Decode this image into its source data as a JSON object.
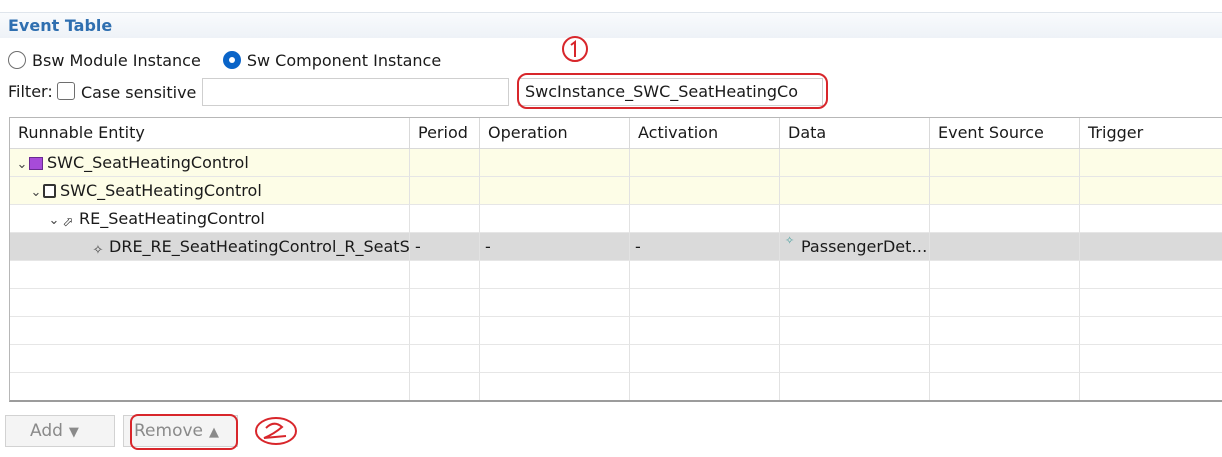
{
  "section": {
    "title": "Event Table"
  },
  "radios": [
    {
      "label": "Bsw Module Instance",
      "checked": false
    },
    {
      "label": "Sw Component Instance",
      "checked": true
    }
  ],
  "filter": {
    "label": "Filter:",
    "case_sensitive_label": "Case sensitive",
    "case_sensitive_checked": false,
    "text_value": "",
    "instance_value": "SwcInstance_SWC_SeatHeatingCo"
  },
  "table": {
    "columns": [
      "Runnable Entity",
      "Period",
      "Operation",
      "Activation",
      "Data",
      "Event Source",
      "Trigger"
    ],
    "rows": [
      {
        "name": "SWC_SeatHeatingControl",
        "icon": "component-prototype-icon",
        "period": "",
        "operation": "",
        "activation": "",
        "data": "",
        "event_source": "",
        "trigger": ""
      },
      {
        "name": "SWC_SeatHeatingControl",
        "icon": "swc-type-icon",
        "period": "",
        "operation": "",
        "activation": "",
        "data": "",
        "event_source": "",
        "trigger": ""
      },
      {
        "name": "RE_SeatHeatingControl",
        "icon": "runnable-icon",
        "period": "",
        "operation": "",
        "activation": "",
        "data": "",
        "event_source": "",
        "trigger": ""
      },
      {
        "name": "DRE_RE_SeatHeatingControl_R_SeatS",
        "icon": "data-received-event-icon",
        "period": "-",
        "operation": "-",
        "activation": "-",
        "data": "PassengerDet…",
        "event_source": "",
        "trigger": ""
      }
    ]
  },
  "buttons": {
    "add": "Add",
    "remove": "Remove"
  },
  "annotations": {
    "one": "1",
    "two": "2"
  },
  "colors": {
    "accent": "#2f6fb0",
    "annotation": "#d8262b",
    "selected_row": "#dadada",
    "highlight_row": "#fdfde7"
  }
}
